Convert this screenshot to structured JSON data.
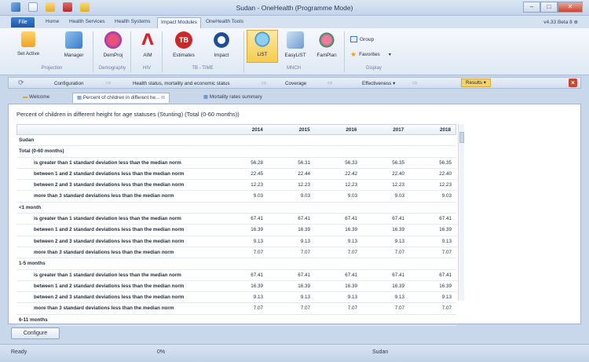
{
  "window": {
    "title": "Sudan - OneHealth (Programme Mode)",
    "controls": {
      "minimize": "–",
      "maximize": "□",
      "close": "✕"
    }
  },
  "ribbon_tabs": [
    "File",
    "Home",
    "Health Services",
    "Health Systems",
    "Impact Modules",
    "OneHealth Tools"
  ],
  "version": "v4.33 Beta 8",
  "ribbon": {
    "buttons": [
      {
        "label": "Set Active",
        "icon": "set-active-icon"
      },
      {
        "label": "Manager",
        "icon": "manager-icon"
      },
      {
        "label": "DemProj",
        "icon": "demproj-icon"
      },
      {
        "label": "AIM",
        "icon": "aim-icon"
      },
      {
        "label": "Estimates",
        "icon": "tb-estimates-icon"
      },
      {
        "label": "Impact",
        "icon": "impact-icon"
      },
      {
        "label": "LiST",
        "icon": "list-icon"
      },
      {
        "label": "EasyLiST",
        "icon": "easylist-icon"
      },
      {
        "label": "FamPlan",
        "icon": "famplan-icon"
      }
    ],
    "groups": [
      "Projection",
      "Demography",
      "HIV",
      "TB - TIME",
      "MNCH",
      "Display"
    ],
    "display": {
      "group_label": "Group",
      "favorites_label": "Favorites"
    }
  },
  "workflow": {
    "items": [
      "Configuration",
      "Health status, mortality and economic status",
      "Coverage",
      "Effectiveness",
      "Results"
    ],
    "active": "Results"
  },
  "doc_tabs": [
    "Welcome",
    "Percent of children in different he...",
    "Mortality rates summary"
  ],
  "content": {
    "heading": "Percent of children in different height for age statuses (Stunting) (Total (0-60 months))",
    "columns": [
      "",
      "2014",
      "2015",
      "2016",
      "2017",
      "2018"
    ],
    "rows": [
      {
        "type": "group",
        "label": "Sudan"
      },
      {
        "type": "group",
        "label": "Total (0-60 months)"
      },
      {
        "type": "data",
        "label": "is greater than 1 standard deviation less than the median norm",
        "values": [
          "56.28",
          "56.31",
          "56.33",
          "56.35",
          "56.35"
        ]
      },
      {
        "type": "data",
        "label": "between 1 and 2 standard deviations less than the median norm",
        "values": [
          "22.45",
          "22.44",
          "22.42",
          "22.40",
          "22.40"
        ]
      },
      {
        "type": "data",
        "label": "between 2 and 3 standard deviations less than the median norm",
        "values": [
          "12.23",
          "12.23",
          "12.23",
          "12.23",
          "12.23"
        ]
      },
      {
        "type": "data",
        "label": "more than 3 standard deviations less than the median norm",
        "values": [
          "9.03",
          "9.03",
          "9.03",
          "9.03",
          "9.03"
        ]
      },
      {
        "type": "group",
        "label": "<1 month"
      },
      {
        "type": "data",
        "label": "is greater than 1 standard deviation less than the median norm",
        "values": [
          "67.41",
          "67.41",
          "67.41",
          "67.41",
          "67.41"
        ]
      },
      {
        "type": "data",
        "label": "between 1 and 2 standard deviations less than the median norm",
        "values": [
          "16.39",
          "16.39",
          "16.39",
          "16.39",
          "16.39"
        ]
      },
      {
        "type": "data",
        "label": "between 2 and 3 standard deviations less than the median norm",
        "values": [
          "9.13",
          "9.13",
          "9.13",
          "9.13",
          "9.13"
        ]
      },
      {
        "type": "data",
        "label": "more than 3 standard deviations less than the median norm",
        "values": [
          "7.07",
          "7.07",
          "7.07",
          "7.07",
          "7.07"
        ]
      },
      {
        "type": "group",
        "label": "1-5 months"
      },
      {
        "type": "data",
        "label": "is greater than 1 standard deviation less than the median norm",
        "values": [
          "67.41",
          "67.41",
          "67.41",
          "67.41",
          "67.41"
        ]
      },
      {
        "type": "data",
        "label": "between 1 and 2 standard deviations less than the median norm",
        "values": [
          "16.39",
          "16.39",
          "16.39",
          "16.39",
          "16.39"
        ]
      },
      {
        "type": "data",
        "label": "between 2 and 3 standard deviations less than the median norm",
        "values": [
          "9.13",
          "9.13",
          "9.13",
          "9.13",
          "9.13"
        ]
      },
      {
        "type": "data",
        "label": "more than 3 standard deviations less than the median norm",
        "values": [
          "7.07",
          "7.07",
          "7.07",
          "7.07",
          "7.07"
        ]
      },
      {
        "type": "group",
        "label": "6-11 months"
      }
    ]
  },
  "configure_label": "Configure",
  "status": {
    "left": "Ready",
    "progress": "0%",
    "country": "Sudan"
  },
  "colors": {
    "accent": "#f6d36a",
    "file_tab": "#1f57a6",
    "close": "#c8452f"
  }
}
